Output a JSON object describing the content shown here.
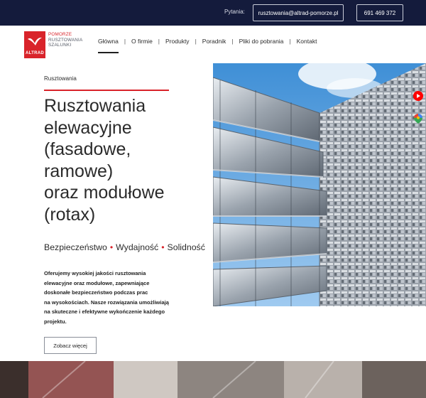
{
  "topbar": {
    "question_label": "Pytania:",
    "email": "rusztowania@altrad-pomorze.pl",
    "phone": "691 469 372"
  },
  "logo": {
    "brand": "ALTRAD",
    "line1": "POMORZE",
    "line2": "RUSZTOWANIA",
    "line3": "SZALUNKI"
  },
  "nav": {
    "items": [
      {
        "label": "Główna",
        "active": true
      },
      {
        "label": "O firmie"
      },
      {
        "label": "Produkty"
      },
      {
        "label": "Poradnik"
      },
      {
        "label": "Pliki do pobrania"
      },
      {
        "label": "Kontakt"
      }
    ]
  },
  "hero": {
    "breadcrumb": "Rusztowania",
    "title_lines": [
      "Rusztowania",
      "elewacyjne",
      "(fasadowe,",
      "ramowe)",
      "oraz modułowe",
      "(rotax)"
    ],
    "tagline": [
      "Bezpieczeństwo",
      "Wydajność",
      "Solidność"
    ],
    "desc_lines": [
      "Oferujemy wysokiej jakości rusztowania",
      "elewacyjne oraz modułowe, zapewniające",
      "doskonałe bezpieczeństwo podczas prac",
      "na wysokościach. Nasze rozwiązania umożliwiają",
      "na skuteczne i efektywne wykończenie każdego",
      "projektu."
    ],
    "button_label": "Zobacz więcej"
  },
  "side_icons": [
    "youtube-icon",
    "google-maps-icon"
  ],
  "colors": {
    "topbar_bg": "#141b3c",
    "accent_red": "#d9232a",
    "text_dark": "#2b2b2b"
  }
}
